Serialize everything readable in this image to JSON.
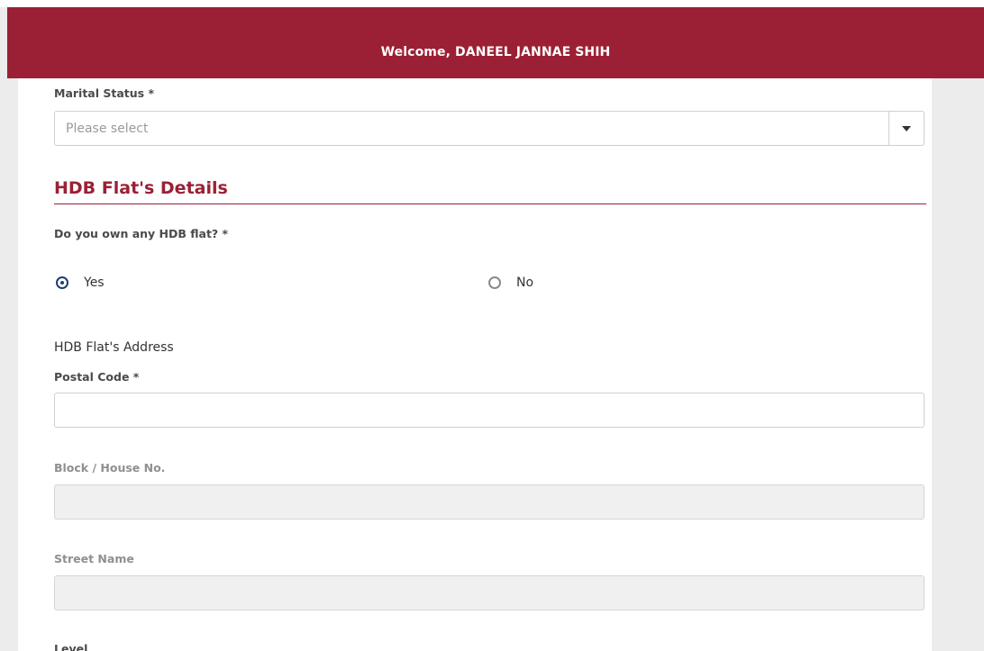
{
  "header": {
    "welcome": "Welcome, DANEEL JANNAE SHIH"
  },
  "marital_status": {
    "label": "Marital Status *",
    "placeholder": "Please select"
  },
  "section": {
    "title": "HDB Flat's Details"
  },
  "own_flat": {
    "question": "Do you own any HDB flat? *",
    "options": [
      {
        "label": "Yes",
        "selected": true
      },
      {
        "label": "No",
        "selected": false
      }
    ]
  },
  "address": {
    "heading": "HDB Flat's Address",
    "postal_code": {
      "label": "Postal Code *",
      "value": ""
    },
    "block": {
      "label": "Block / House No.",
      "value": ""
    },
    "street": {
      "label": "Street Name",
      "value": ""
    },
    "level": {
      "label": "Level"
    }
  },
  "colors": {
    "brand": "#9b2035",
    "radio_checked": "#1f3f73"
  },
  "icons": {
    "select_caret": "caret-down-icon"
  }
}
